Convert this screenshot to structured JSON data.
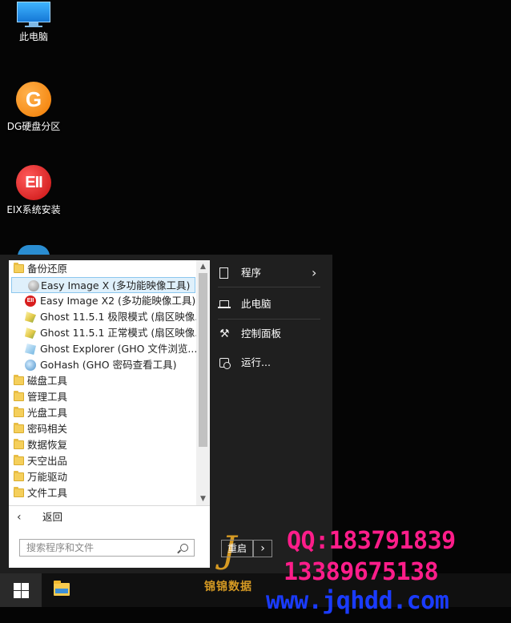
{
  "desktop": {
    "icons": [
      {
        "label": "此电脑",
        "icon": "computer-icon"
      },
      {
        "label": "DG硬盘分区",
        "icon": "dg-icon",
        "glyph": "G"
      },
      {
        "label": "EIX系统安装",
        "icon": "eix-icon",
        "glyph": "EII"
      }
    ]
  },
  "start_menu": {
    "tree": {
      "open_folder": "备份还原",
      "items": [
        {
          "label": "Easy Image X (多功能映像工具)",
          "icon": "easy-image-icon",
          "selected": true
        },
        {
          "label": "Easy Image X2 (多功能映像工具)",
          "icon": "eii-icon",
          "glyph": "EII"
        },
        {
          "label": "Ghost 11.5.1 极限模式 (扇区映像...",
          "icon": "ghost-icon"
        },
        {
          "label": "Ghost 11.5.1 正常模式 (扇区映像...",
          "icon": "ghost-icon"
        },
        {
          "label": "Ghost Explorer (GHO 文件浏览...",
          "icon": "ghost-explorer-icon"
        },
        {
          "label": "GoHash (GHO 密码查看工具)",
          "icon": "gohash-icon"
        }
      ],
      "folders": [
        "磁盘工具",
        "管理工具",
        "光盘工具",
        "密码相关",
        "数据恢复",
        "天空出品",
        "万能驱动",
        "文件工具"
      ]
    },
    "scroll": {
      "up": "▲",
      "down": "▼"
    },
    "back": {
      "arrow": "‹",
      "label": "返回"
    },
    "search": {
      "placeholder": "搜索程序和文件"
    },
    "right_panel": {
      "programs": "程序",
      "chevron": "›",
      "this_pc": "此电脑",
      "control_panel": "控制面板",
      "run": "运行..."
    },
    "restart": {
      "label": "重启",
      "arrow": "›"
    }
  },
  "watermark": {
    "logo_letter": "J",
    "brand": "锦锦数据",
    "qq": "QQ:183791839",
    "phone": "13389675138",
    "url": "www.jqhdd.com",
    "colors": {
      "qq": "#ff1d8a",
      "url": "#1a3bff",
      "brand": "#d69a23"
    }
  }
}
